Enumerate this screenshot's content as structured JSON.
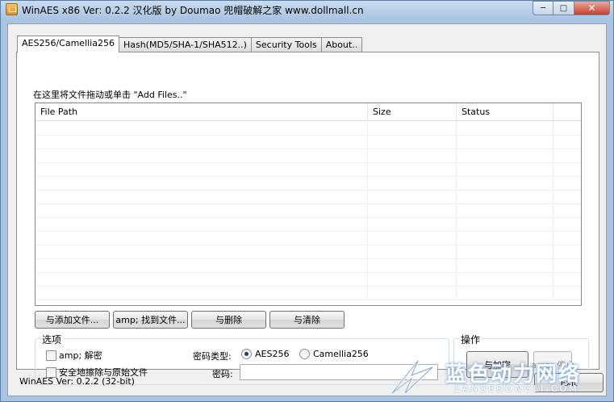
{
  "window": {
    "title": "WinAES x86 Ver: 0.2.2 汉化版 by Doumao 兜帽破解之家 www.dollmall.cn",
    "controls": [
      "minimize",
      "maximize",
      "close"
    ]
  },
  "tabs": [
    {
      "label": "AES256/Camellia256",
      "active": true
    },
    {
      "label": "Hash(MD5/SHA-1/SHA512..)",
      "active": false
    },
    {
      "label": "Security Tools",
      "active": false
    },
    {
      "label": "About..",
      "active": false
    }
  ],
  "file_panel": {
    "hint": "在这里将文件拖动或单击 \"Add Files..\"",
    "columns": [
      "File Path",
      "Size",
      "Status",
      ""
    ],
    "rows": []
  },
  "file_buttons": {
    "add": "与添加文件...",
    "find": "amp; 找到文件...",
    "delete": "与删除",
    "clear": "与清除"
  },
  "options": {
    "title": "选项",
    "decrypt_label": "amp; 解密",
    "decrypt_checked": false,
    "secure_delete_label": "安全地擦除与原始文件",
    "secure_delete_checked": false,
    "cipher_type_label": "密码类型:",
    "cipher_options": [
      {
        "label": "AES256",
        "selected": true
      },
      {
        "label": "Camellia256",
        "selected": false
      }
    ],
    "password_label": "密码:",
    "password_value": ""
  },
  "operation": {
    "title": "操作",
    "encrypt": "与加密",
    "stop": "amp; 停止"
  },
  "status": {
    "version": "WinAES Ver: 0.2.2 (32-bit)",
    "exit": "Exit"
  },
  "watermark": {
    "cn": "蓝色动力网络",
    "en": "LANSEDONGLI.COM"
  }
}
